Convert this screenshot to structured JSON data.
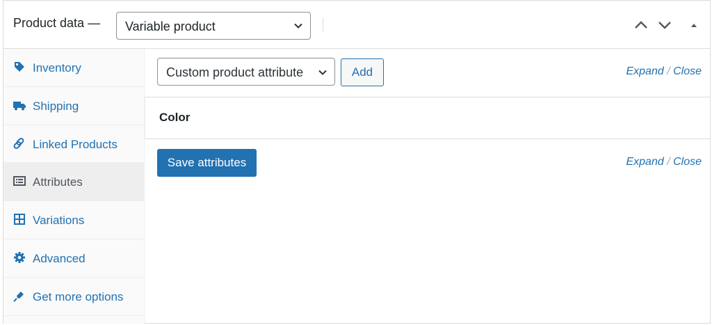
{
  "header": {
    "title": "Product data —",
    "product_type": "Variable product",
    "buttons": [
      "chevron-up-icon",
      "chevron-down-icon",
      "collapse-arrow-icon"
    ]
  },
  "sidebar": {
    "items": [
      {
        "label": "Inventory",
        "icon": "tag-icon",
        "active": false
      },
      {
        "label": "Shipping",
        "icon": "truck-icon",
        "active": false
      },
      {
        "label": "Linked Products",
        "icon": "link-icon",
        "active": false
      },
      {
        "label": "Attributes",
        "icon": "list-icon",
        "active": true
      },
      {
        "label": "Variations",
        "icon": "grid-icon",
        "active": false
      },
      {
        "label": "Advanced",
        "icon": "gear-icon",
        "active": false
      },
      {
        "label": "Get more options",
        "icon": "plugin-icon",
        "active": false
      }
    ]
  },
  "main": {
    "attribute_select": "Custom product attribute",
    "add_label": "Add",
    "expand_label": "Expand",
    "separator": "/",
    "close_label": "Close",
    "attributes": [
      {
        "name": "Color"
      }
    ],
    "save_label": "Save attributes"
  },
  "colors": {
    "accent": "#2271b1",
    "active_tab_bg": "#eeeeee",
    "border": "#dcdcde"
  }
}
